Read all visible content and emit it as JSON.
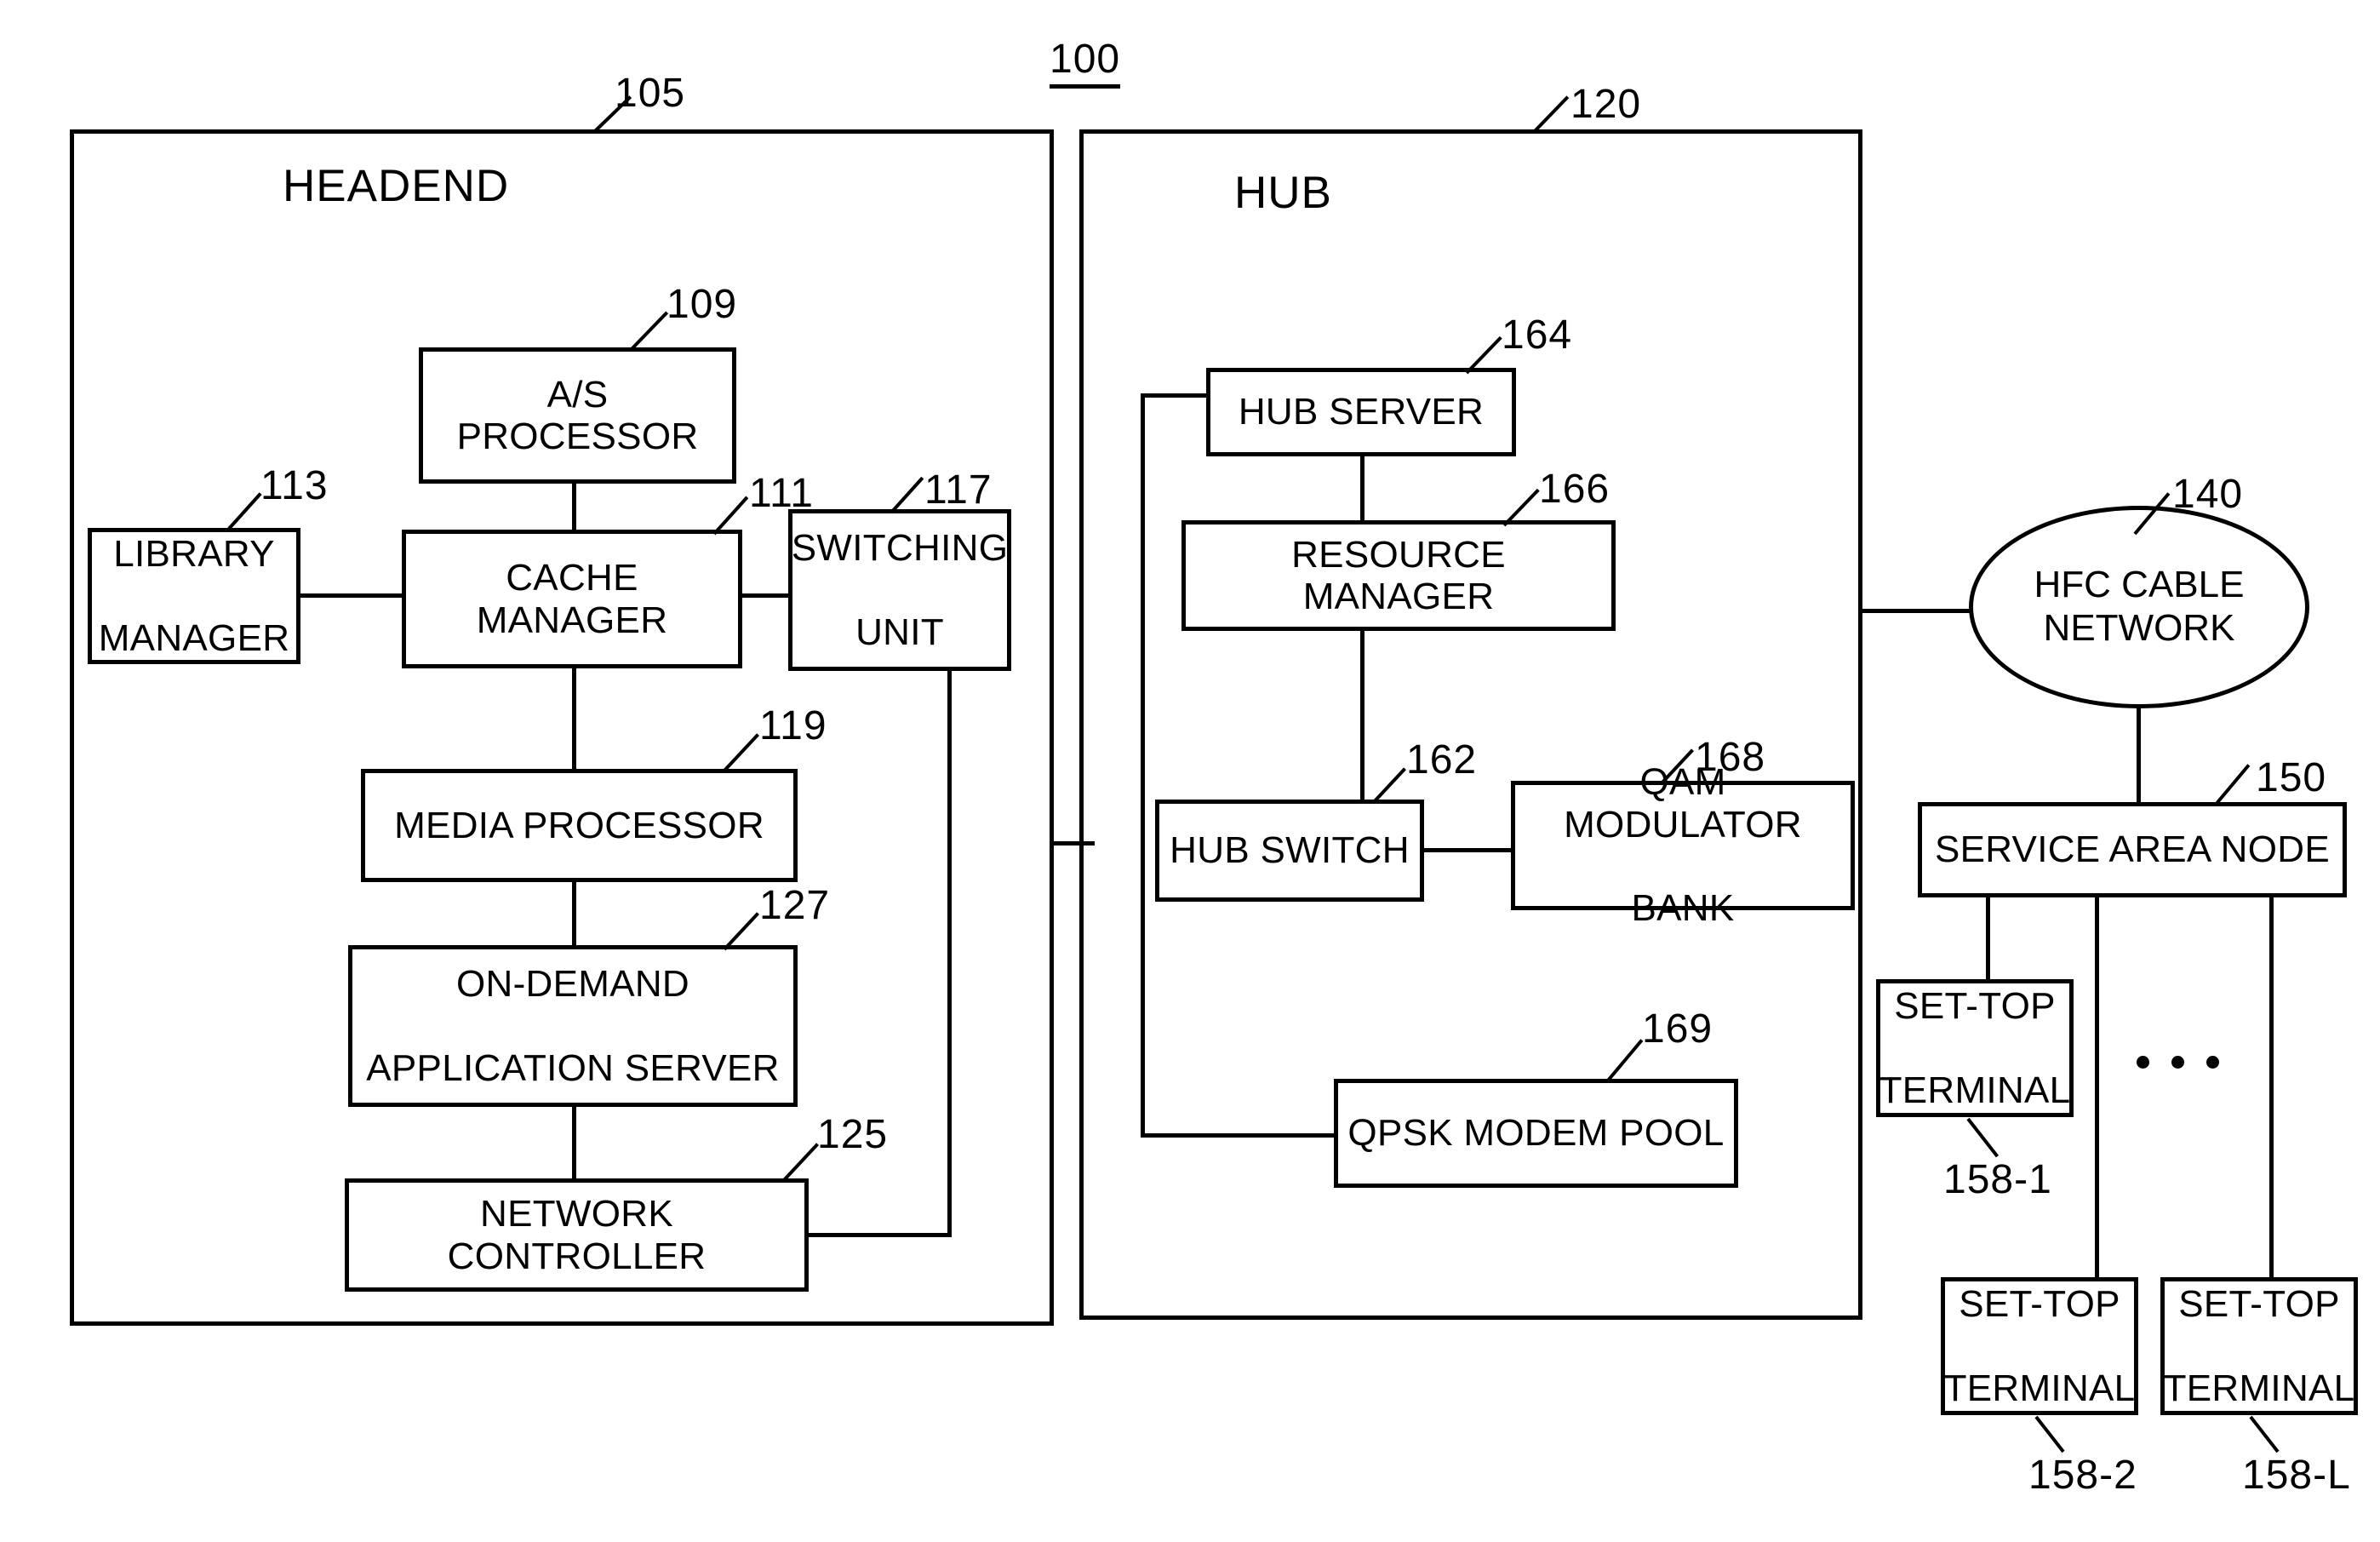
{
  "figure": {
    "system_ref": "100"
  },
  "regions": [
    {
      "name": "headend",
      "title": "HEADEND",
      "ref": "105"
    },
    {
      "name": "hub",
      "title": "HUB",
      "ref": "120"
    }
  ],
  "headend": {
    "title": "HEADEND",
    "ref": "105",
    "nodes": [
      {
        "label": "A/S PROCESSOR",
        "ref": "109"
      },
      {
        "label": "LIBRARY MANAGER",
        "line1": "LIBRARY",
        "line2": "MANAGER",
        "ref": "113"
      },
      {
        "label": "CACHE MANAGER",
        "ref": "111"
      },
      {
        "label": "SWITCHING UNIT",
        "line1": "SWITCHING",
        "line2": "UNIT",
        "ref": "117"
      },
      {
        "label": "MEDIA PROCESSOR",
        "ref": "119"
      },
      {
        "label": "ON-DEMAND APPLICATION SERVER",
        "line1": "ON-DEMAND",
        "line2": "APPLICATION SERVER",
        "ref": "127"
      },
      {
        "label": "NETWORK CONTROLLER",
        "ref": "125"
      }
    ]
  },
  "hub": {
    "title": "HUB",
    "ref": "120",
    "nodes": [
      {
        "label": "HUB SERVER",
        "ref": "164"
      },
      {
        "label": "RESOURCE MANAGER",
        "ref": "166"
      },
      {
        "label": "HUB SWITCH",
        "ref": "162"
      },
      {
        "label": "QAM MODULATOR BANK",
        "line1": "QAM MODULATOR",
        "line2": "BANK",
        "ref": "168"
      },
      {
        "label": "QPSK MODEM POOL",
        "ref": "169"
      }
    ]
  },
  "network": {
    "hfc": {
      "label": "HFC CABLE NETWORK",
      "line1": "HFC CABLE",
      "line2": "NETWORK",
      "ref": "140"
    },
    "service_area_node": {
      "label": "SERVICE AREA NODE",
      "ref": "150"
    },
    "terminals": [
      {
        "line1": "SET-TOP",
        "line2": "TERMINAL",
        "ref": "158-1"
      },
      {
        "line1": "SET-TOP",
        "line2": "TERMINAL",
        "ref": "158-2"
      },
      {
        "line1": "SET-TOP",
        "line2": "TERMINAL",
        "ref": "158-L"
      }
    ],
    "ellipsis": "• • •"
  }
}
